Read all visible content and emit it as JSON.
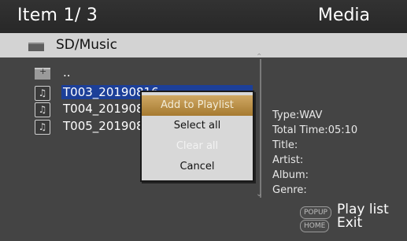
{
  "header": {
    "item_count": "Item 1/ 3",
    "title": "Media"
  },
  "path": {
    "text": "SD/Music",
    "icon": "folder-icon"
  },
  "files": [
    {
      "name": "..",
      "icon": "parent-folder-icon",
      "selected": false
    },
    {
      "name": "T003_20190816",
      "icon": "music-file-icon",
      "selected": true
    },
    {
      "name": "T004_201908",
      "icon": "music-file-icon",
      "selected": false
    },
    {
      "name": "T005_201908",
      "icon": "music-file-icon",
      "selected": false
    }
  ],
  "info": {
    "type": "Type:WAV",
    "total_time": "Total Time:05:10",
    "title": "Title:",
    "artist": "Artist:",
    "album": "Album:",
    "genre": "Genre:"
  },
  "popup_menu": {
    "items": [
      {
        "label": "Add to Playlist",
        "state": "highlighted"
      },
      {
        "label": "Select all",
        "state": "enabled"
      },
      {
        "label": "Clear all",
        "state": "disabled"
      },
      {
        "label": "Cancel",
        "state": "enabled"
      }
    ]
  },
  "footer": {
    "popup_key": "POPUP",
    "popup_label": "Play list",
    "home_key": "HOME",
    "home_label": "Exit"
  },
  "colors": {
    "selection": "#1c3f98",
    "menu_highlight": "#b88a3e",
    "background": "#444444"
  }
}
